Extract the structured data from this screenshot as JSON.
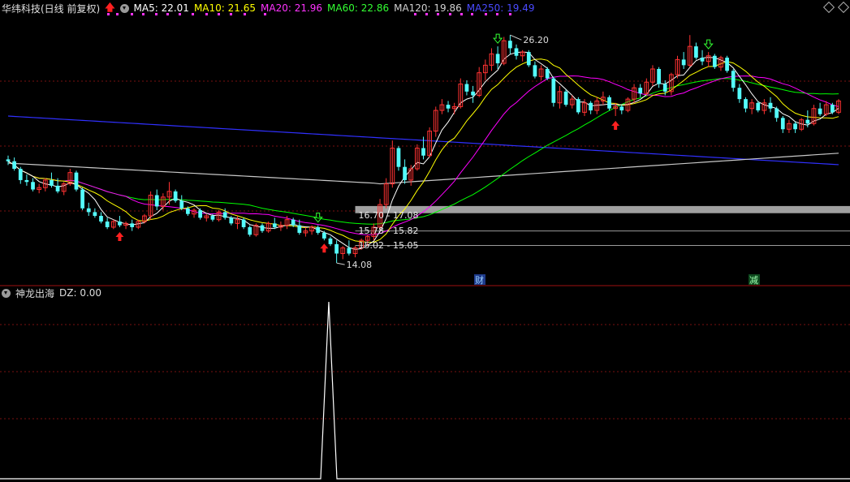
{
  "header": {
    "stock_title": "华纬科技(日线 前复权)",
    "ma5": "MA5: 22.01",
    "ma10": "MA10: 21.65",
    "ma20": "MA20: 21.96",
    "ma60": "MA60: 22.86",
    "ma120": "MA120: 19.86",
    "ma250": "MA250: 19.49"
  },
  "sub_header": {
    "indicator_name": "神龙出海",
    "dz_value": "DZ: 0.00"
  },
  "colors": {
    "up": "#ff3232",
    "down": "#54fcfc",
    "ma5": "#ffffff",
    "ma10": "#ffff00",
    "ma20": "#ff00ff",
    "ma60": "#00ff00",
    "ma120": "#c8c8c8",
    "ma250": "#3030ff",
    "grid": "#7a1010"
  },
  "chart_data": {
    "type": "candlestick",
    "price_annotations": [
      "26.20",
      "14.08"
    ],
    "support_zones": [
      "16.70 - 17.08",
      "15.78 - 15.82",
      "15.02 - 15.05"
    ],
    "event_tags": [
      "财",
      "减"
    ],
    "candles": [
      [
        19.6,
        19.8,
        19.3,
        19.5
      ],
      [
        19.5,
        19.7,
        19.0,
        19.1
      ],
      [
        19.1,
        19.2,
        18.3,
        18.5
      ],
      [
        18.5,
        18.8,
        18.2,
        18.4
      ],
      [
        18.4,
        18.6,
        17.9,
        18.0
      ],
      [
        18.0,
        18.3,
        17.8,
        18.1
      ],
      [
        18.1,
        18.6,
        17.9,
        18.5
      ],
      [
        18.5,
        18.9,
        18.1,
        18.2
      ],
      [
        18.2,
        18.6,
        17.8,
        17.9
      ],
      [
        17.9,
        18.4,
        17.7,
        18.3
      ],
      [
        18.3,
        19.1,
        18.2,
        18.9
      ],
      [
        18.9,
        19.0,
        17.9,
        18.0
      ],
      [
        18.0,
        18.1,
        16.9,
        17.0
      ],
      [
        17.0,
        17.3,
        16.6,
        16.8
      ],
      [
        16.8,
        17.0,
        16.5,
        16.6
      ],
      [
        16.6,
        16.8,
        16.2,
        16.3
      ],
      [
        16.3,
        16.5,
        15.9,
        16.0
      ],
      [
        16.0,
        16.4,
        15.9,
        16.3
      ],
      [
        16.3,
        16.6,
        16.0,
        16.1
      ],
      [
        16.1,
        16.3,
        15.9,
        16.2
      ],
      [
        16.2,
        16.4,
        15.8,
        16.0
      ],
      [
        16.0,
        16.4,
        15.9,
        16.3
      ],
      [
        16.3,
        16.7,
        16.2,
        16.6
      ],
      [
        16.6,
        17.9,
        16.4,
        17.7
      ],
      [
        17.7,
        18.0,
        16.9,
        17.1
      ],
      [
        17.1,
        17.8,
        16.9,
        17.6
      ],
      [
        17.6,
        18.4,
        17.2,
        17.9
      ],
      [
        17.9,
        18.0,
        17.3,
        17.4
      ],
      [
        17.4,
        17.7,
        16.9,
        17.0
      ],
      [
        17.0,
        17.1,
        16.6,
        16.7
      ],
      [
        16.7,
        17.0,
        16.5,
        16.9
      ],
      [
        16.9,
        17.0,
        16.4,
        16.5
      ],
      [
        16.5,
        16.7,
        16.3,
        16.6
      ],
      [
        16.6,
        16.7,
        16.3,
        16.4
      ],
      [
        16.4,
        16.9,
        16.3,
        16.8
      ],
      [
        16.8,
        17.0,
        16.4,
        16.5
      ],
      [
        16.5,
        16.6,
        16.1,
        16.2
      ],
      [
        16.2,
        16.6,
        15.9,
        16.4
      ],
      [
        16.4,
        16.5,
        15.9,
        16.0
      ],
      [
        16.0,
        16.1,
        15.5,
        15.6
      ],
      [
        15.6,
        16.2,
        15.5,
        16.1
      ],
      [
        16.1,
        16.2,
        15.7,
        15.8
      ],
      [
        15.8,
        16.3,
        15.7,
        16.2
      ],
      [
        16.2,
        16.5,
        15.9,
        16.0
      ],
      [
        16.0,
        16.3,
        15.8,
        16.1
      ],
      [
        16.1,
        16.6,
        15.9,
        16.4
      ],
      [
        16.4,
        16.5,
        16.0,
        16.1
      ],
      [
        16.1,
        16.4,
        15.6,
        15.7
      ],
      [
        15.7,
        16.0,
        15.5,
        15.8
      ],
      [
        15.8,
        16.1,
        15.6,
        16.0
      ],
      [
        16.0,
        16.1,
        15.6,
        15.7
      ],
      [
        15.7,
        15.8,
        15.3,
        15.4
      ],
      [
        15.4,
        15.5,
        15.0,
        15.1
      ],
      [
        15.1,
        15.3,
        14.1,
        14.6
      ],
      [
        14.6,
        15.0,
        14.3,
        14.9
      ],
      [
        14.9,
        15.3,
        14.5,
        14.6
      ],
      [
        14.6,
        15.0,
        14.4,
        14.9
      ],
      [
        14.9,
        15.4,
        14.8,
        15.3
      ],
      [
        15.3,
        15.6,
        15.0,
        15.5
      ],
      [
        15.5,
        16.2,
        15.3,
        16.0
      ],
      [
        16.0,
        17.5,
        15.8,
        17.2
      ],
      [
        17.2,
        18.6,
        17.0,
        18.3
      ],
      [
        18.3,
        20.6,
        18.1,
        20.2
      ],
      [
        20.2,
        20.3,
        19.0,
        19.2
      ],
      [
        19.2,
        19.6,
        18.3,
        18.5
      ],
      [
        18.5,
        19.3,
        18.2,
        19.1
      ],
      [
        19.1,
        20.4,
        19.0,
        20.2
      ],
      [
        20.2,
        20.8,
        19.6,
        19.8
      ],
      [
        19.8,
        21.3,
        19.7,
        21.1
      ],
      [
        21.1,
        22.4,
        20.8,
        22.2
      ],
      [
        22.2,
        22.8,
        22.0,
        22.5
      ],
      [
        22.5,
        22.7,
        22.1,
        22.3
      ],
      [
        22.3,
        22.6,
        22.0,
        22.4
      ],
      [
        22.4,
        23.9,
        22.3,
        23.6
      ],
      [
        23.6,
        23.8,
        23.0,
        23.2
      ],
      [
        23.2,
        23.5,
        22.6,
        23.0
      ],
      [
        23.0,
        24.5,
        22.9,
        24.2
      ],
      [
        24.2,
        24.9,
        23.8,
        24.6
      ],
      [
        24.6,
        25.5,
        24.3,
        25.2
      ],
      [
        25.2,
        25.6,
        24.4,
        24.7
      ],
      [
        24.7,
        26.1,
        24.6,
        25.9
      ],
      [
        25.9,
        26.2,
        25.2,
        25.5
      ],
      [
        25.5,
        25.7,
        24.9,
        25.1
      ],
      [
        25.1,
        25.4,
        24.8,
        25.3
      ],
      [
        25.3,
        25.4,
        24.5,
        24.6
      ],
      [
        24.6,
        24.8,
        23.9,
        24.0
      ],
      [
        24.0,
        24.6,
        23.8,
        24.4
      ],
      [
        24.4,
        24.5,
        23.8,
        23.9
      ],
      [
        23.9,
        24.0,
        22.4,
        22.6
      ],
      [
        22.6,
        23.5,
        22.3,
        23.2
      ],
      [
        23.2,
        23.3,
        22.4,
        22.5
      ],
      [
        22.5,
        23.0,
        22.3,
        22.8
      ],
      [
        22.8,
        22.9,
        22.0,
        22.1
      ],
      [
        22.1,
        22.8,
        21.9,
        22.6
      ],
      [
        22.6,
        22.7,
        22.0,
        22.2
      ],
      [
        22.2,
        22.9,
        22.0,
        22.7
      ],
      [
        22.7,
        23.2,
        22.5,
        22.9
      ],
      [
        22.9,
        23.0,
        22.2,
        22.3
      ],
      [
        22.3,
        22.6,
        21.9,
        22.4
      ],
      [
        22.4,
        22.5,
        22.0,
        22.2
      ],
      [
        22.2,
        22.9,
        22.1,
        22.8
      ],
      [
        22.8,
        23.6,
        22.6,
        23.4
      ],
      [
        23.4,
        23.6,
        22.9,
        23.1
      ],
      [
        23.1,
        23.9,
        23.0,
        23.7
      ],
      [
        23.7,
        24.6,
        23.5,
        24.4
      ],
      [
        24.4,
        24.5,
        23.4,
        23.6
      ],
      [
        23.6,
        23.8,
        23.0,
        23.2
      ],
      [
        23.2,
        24.2,
        23.0,
        24.1
      ],
      [
        24.1,
        25.1,
        23.9,
        24.9
      ],
      [
        24.9,
        25.3,
        24.4,
        24.6
      ],
      [
        24.6,
        26.2,
        24.5,
        25.6
      ],
      [
        25.6,
        25.8,
        24.9,
        25.0
      ],
      [
        25.0,
        25.4,
        24.6,
        24.8
      ],
      [
        24.8,
        25.3,
        24.5,
        25.1
      ],
      [
        25.1,
        25.2,
        24.4,
        24.5
      ],
      [
        24.5,
        25.1,
        24.3,
        25.0
      ],
      [
        25.0,
        25.1,
        24.2,
        24.3
      ],
      [
        24.3,
        24.4,
        23.2,
        23.4
      ],
      [
        23.4,
        23.6,
        22.6,
        22.8
      ],
      [
        22.8,
        22.9,
        22.1,
        22.3
      ],
      [
        22.3,
        22.8,
        22.0,
        22.6
      ],
      [
        22.6,
        22.7,
        22.1,
        22.2
      ],
      [
        22.2,
        22.8,
        22.0,
        22.6
      ],
      [
        22.6,
        22.9,
        22.1,
        22.3
      ],
      [
        22.3,
        22.4,
        21.6,
        21.8
      ],
      [
        21.8,
        21.9,
        21.0,
        21.2
      ],
      [
        21.2,
        21.7,
        21.0,
        21.5
      ],
      [
        21.5,
        21.6,
        21.0,
        21.2
      ],
      [
        21.2,
        21.8,
        21.1,
        21.7
      ],
      [
        21.7,
        22.2,
        21.3,
        21.5
      ],
      [
        21.5,
        22.5,
        21.4,
        22.3
      ],
      [
        22.3,
        22.6,
        21.9,
        22.0
      ],
      [
        22.0,
        22.7,
        21.9,
        22.5
      ],
      [
        22.5,
        22.6,
        22.0,
        22.1
      ],
      [
        22.1,
        22.8,
        22.0,
        22.7
      ]
    ],
    "indicator": {
      "name": "DZ",
      "spike_index": 52,
      "spike_value": 1,
      "baseline": 0
    }
  }
}
